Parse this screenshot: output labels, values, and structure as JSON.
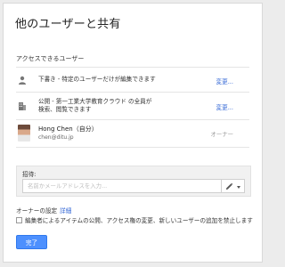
{
  "dialog": {
    "title": "他のユーザーと共有"
  },
  "access": {
    "section_label": "アクセスできるユーザー",
    "rows": [
      {
        "icon": "person-icon",
        "text": "下書き - 特定のユーザーだけが編集できます",
        "action": "変更..."
      },
      {
        "icon": "building-icon",
        "text_line1": "公開 - 第一工業大学教育クラウド の全員が",
        "text_line2": "検索、閲覧できます",
        "action": "変更..."
      }
    ],
    "owner": {
      "name": "Hong Chen（自分）",
      "email": "chen@ditu.jp",
      "role": "オーナー"
    }
  },
  "invite": {
    "label": "招待:",
    "placeholder": "名前かメールアドレスを入力...",
    "permission_icon": "pencil-icon"
  },
  "owner_settings": {
    "label": "オーナーの設定",
    "details_link": "詳細"
  },
  "restriction": {
    "label": "編集者によるアイテムの公開、アクセス権の変更、新しいユーザーの追加を禁止します",
    "checked": false
  },
  "done_button": "完了",
  "colors": {
    "accent": "#4d90fe",
    "link": "#3367d6"
  }
}
